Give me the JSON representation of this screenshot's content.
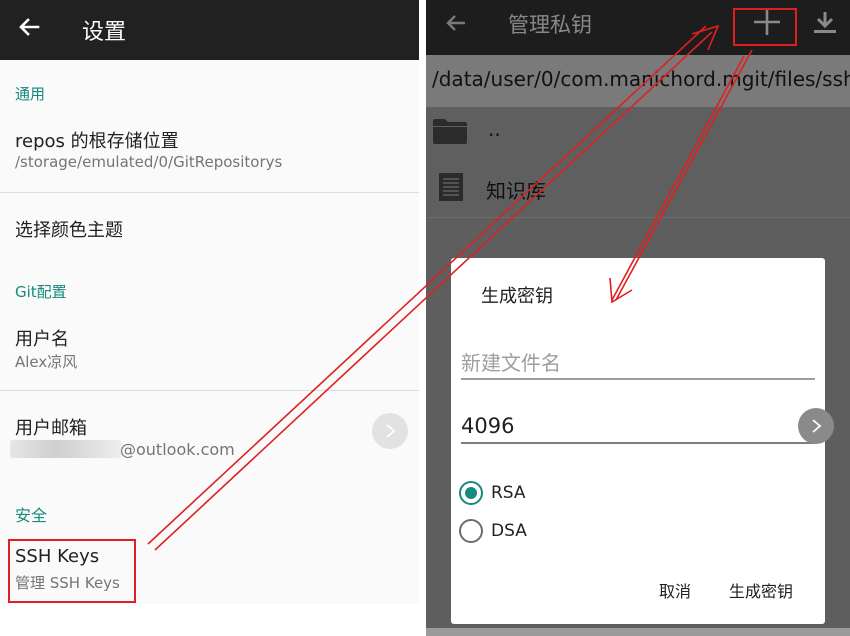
{
  "settings": {
    "title": "设置",
    "sections": {
      "general": "通用",
      "git": "Git配置",
      "security": "安全"
    },
    "repo_location": {
      "label": "repos 的根存储位置",
      "value": "/storage/emulated/0/GitRepositorys"
    },
    "theme": {
      "label": "选择颜色主题"
    },
    "username": {
      "label": "用户名",
      "value": "Alex凉风"
    },
    "email": {
      "label": "用户邮箱",
      "value": "@outlook.com"
    },
    "ssh": {
      "label": "SSH Keys",
      "value": "管理 SSH Keys"
    }
  },
  "keys": {
    "title": "管理私钥",
    "path": "/data/user/0/com.manichord.mgit/files/ssh",
    "files": [
      {
        "name": "..",
        "icon": "folder-icon"
      },
      {
        "name": "知识库",
        "icon": "document-icon"
      }
    ]
  },
  "dialog": {
    "title": "生成密钥",
    "filename_placeholder": "新建文件名",
    "key_length": "4096",
    "options": [
      {
        "label": "RSA",
        "selected": true
      },
      {
        "label": "DSA",
        "selected": false
      }
    ],
    "cancel": "取消",
    "confirm": "生成密钥"
  },
  "colors": {
    "accent": "#168a7d",
    "annotation": "#e02020",
    "toolbar": "#212121"
  }
}
